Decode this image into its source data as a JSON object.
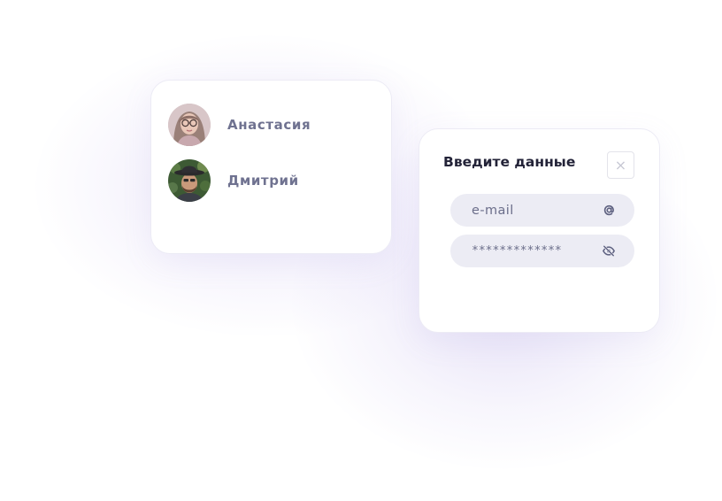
{
  "contacts": [
    {
      "name": "Анастасия",
      "avatar": "woman-with-glasses-avatar"
    },
    {
      "name": "Дмитрий",
      "avatar": "man-with-hat-avatar"
    }
  ],
  "login": {
    "title": "Введите данные",
    "close_symbol": "×",
    "email_field": {
      "value": "e-mail",
      "icon": "at-sign-icon"
    },
    "password_field": {
      "value": "*************",
      "icon": "eye-off-icon"
    }
  },
  "colors": {
    "name_text": "#6f7290",
    "title_text": "#232338",
    "field_background": "#ececf4",
    "glow": "#b9aae8"
  }
}
